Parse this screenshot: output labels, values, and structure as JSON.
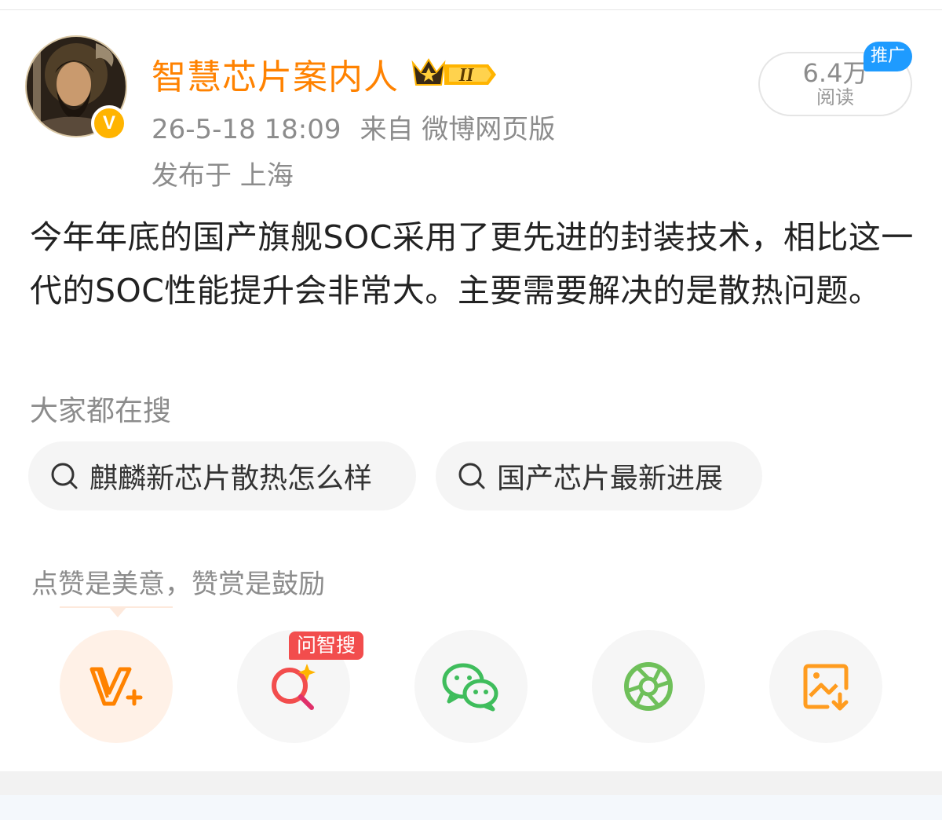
{
  "header": {
    "username": "智慧芯片案内人",
    "member_level": "II",
    "post_time": "26-5-18 18:09",
    "source": "来自 微博网页版",
    "location": "发布于 上海",
    "reads_count": "6.4万",
    "reads_label": "阅读",
    "ad_tag": "推广",
    "verified_badge": "V"
  },
  "post": {
    "text": "今年年底的国产旗舰SOC采用了更先进的封装技术，相比这一代的SOC性能提升会非常大。主要需要解决的是散热问题。"
  },
  "search": {
    "title": "大家都在搜",
    "chips": [
      {
        "label": "麒麟新芯片散热怎么样",
        "icon": "search-icon"
      },
      {
        "label": "国产芯片最新进展",
        "icon": "search-icon"
      }
    ]
  },
  "reward": {
    "text": "点赞是美意，赞赏是鼓励"
  },
  "actions": [
    {
      "name": "reward-v-plus",
      "icon": "v-plus-icon",
      "color": "#ff8200"
    },
    {
      "name": "ask-search",
      "icon": "ai-search-icon",
      "color": "#f24d4d",
      "tag": "问智搜"
    },
    {
      "name": "wechat-share",
      "icon": "wechat-icon",
      "color": "#3fbd5c"
    },
    {
      "name": "moments-share",
      "icon": "moments-icon",
      "color": "#6fc05a"
    },
    {
      "name": "save-image",
      "icon": "save-image-icon",
      "color": "#ff9c1f"
    }
  ],
  "colors": {
    "accent": "#ff8200",
    "ad_blue": "#1e9bff",
    "text": "#222222",
    "muted": "#8c8c8c"
  }
}
